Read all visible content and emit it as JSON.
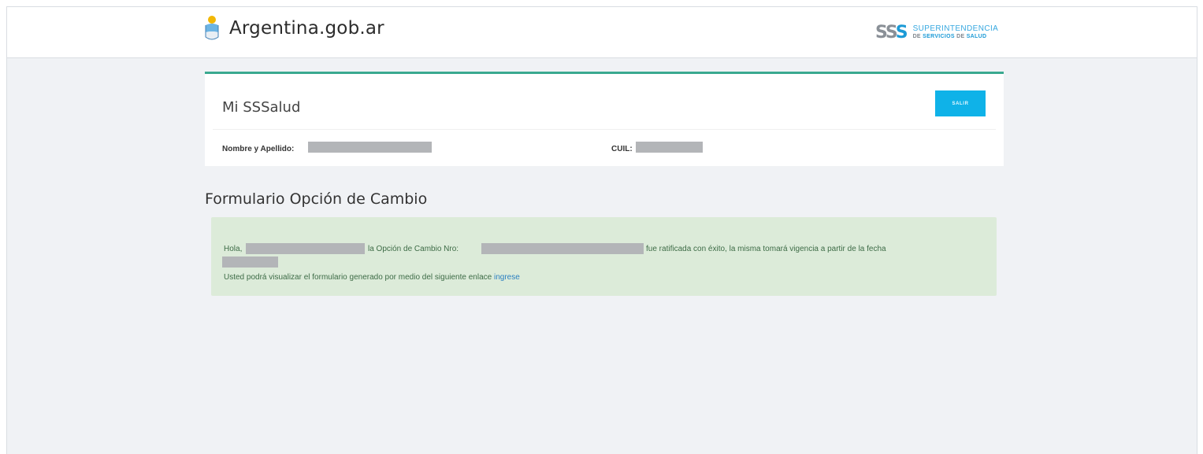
{
  "header": {
    "brand_text": "Argentina.gob.ar",
    "brand_icon": "argentina-coat-of-arms-icon",
    "agency_logo": {
      "mark": "SSS",
      "line1": "SUPERINTENDENCIA",
      "line2_a": "DE",
      "line2_b": "SERVICIOS",
      "line2_c": "DE",
      "line2_d": "SALUD"
    }
  },
  "card": {
    "title": "Mi SSSalud",
    "logout_label": "SALIR",
    "name_label": "Nombre y Apellido:",
    "cuil_label": "CUIL:",
    "accent_color": "#3aa990",
    "button_color": "#0fb2e8"
  },
  "main": {
    "section_title": "Formulario Opción de Cambio",
    "alert": {
      "greeting": "Hola,",
      "middle": "la Opción de Cambio Nro:",
      "ending": "fue ratificada con éxito, la misma tomará vigencia a partir de la fecha",
      "line2": "Usted podrá visualizar el formulario generado por medio del siguiente enlace",
      "link_label": "ingrese",
      "background_color": "#dcebd9"
    }
  }
}
